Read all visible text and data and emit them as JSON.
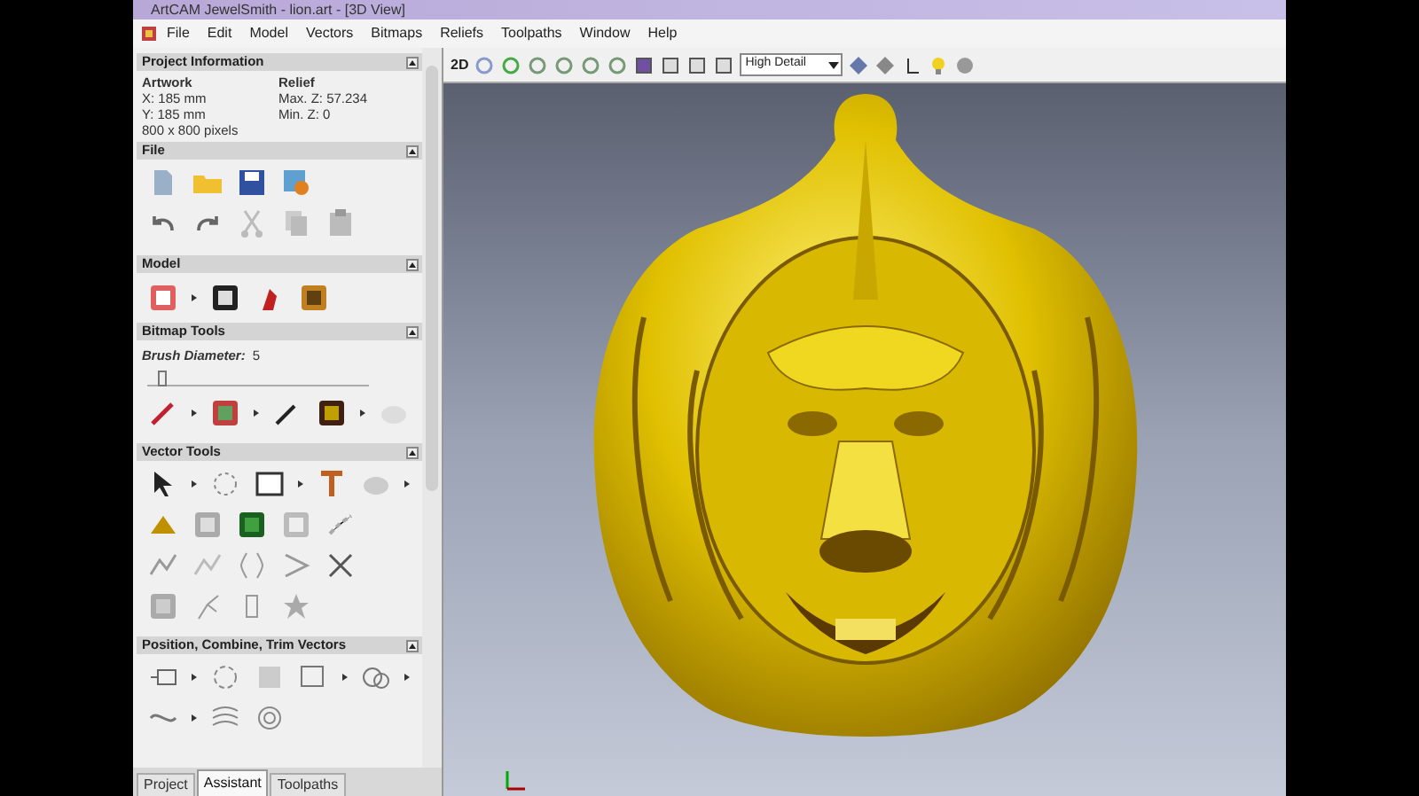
{
  "window": {
    "title": "ArtCAM JewelSmith - lion.art - [3D View]"
  },
  "menu": [
    "File",
    "Edit",
    "Model",
    "Vectors",
    "Bitmaps",
    "Reliefs",
    "Toolpaths",
    "Window",
    "Help"
  ],
  "toolbar": {
    "mode_label": "2D",
    "detail_dropdown": "High Detail"
  },
  "panel": {
    "project_information": {
      "title": "Project Information",
      "artwork_heading": "Artwork",
      "artwork_lines": [
        "X: 185 mm",
        "Y: 185 mm",
        "800 x 800 pixels"
      ],
      "relief_heading": "Relief",
      "relief_lines": [
        "Max. Z: 57.234",
        "Min. Z: 0"
      ]
    },
    "file": {
      "title": "File"
    },
    "model": {
      "title": "Model"
    },
    "bitmap_tools": {
      "title": "Bitmap Tools",
      "brush_label": "Brush Diameter:",
      "brush_value": "5",
      "level": 0.05
    },
    "vector_tools": {
      "title": "Vector Tools"
    },
    "position_tools": {
      "title": "Position, Combine, Trim Vectors"
    }
  },
  "tabs": [
    {
      "label": "Project",
      "selected": false
    },
    {
      "label": "Assistant",
      "selected": true
    },
    {
      "label": "Toolpaths",
      "selected": false
    }
  ]
}
